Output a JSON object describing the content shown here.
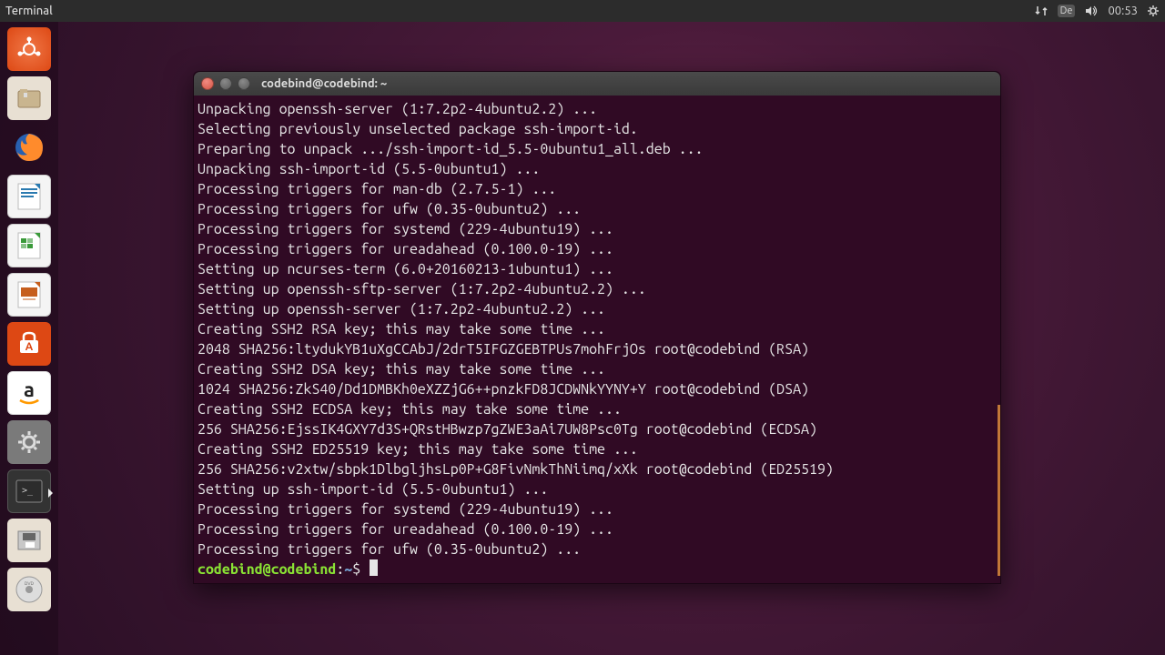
{
  "menubar": {
    "app_name": "Terminal",
    "lang": "De",
    "time": "00:53"
  },
  "terminal": {
    "title": "codebind@codebind: ~",
    "lines": [
      "Unpacking openssh-server (1:7.2p2-4ubuntu2.2) ...",
      "Selecting previously unselected package ssh-import-id.",
      "Preparing to unpack .../ssh-import-id_5.5-0ubuntu1_all.deb ...",
      "Unpacking ssh-import-id (5.5-0ubuntu1) ...",
      "Processing triggers for man-db (2.7.5-1) ...",
      "Processing triggers for ufw (0.35-0ubuntu2) ...",
      "Processing triggers for systemd (229-4ubuntu19) ...",
      "Processing triggers for ureadahead (0.100.0-19) ...",
      "Setting up ncurses-term (6.0+20160213-1ubuntu1) ...",
      "Setting up openssh-sftp-server (1:7.2p2-4ubuntu2.2) ...",
      "Setting up openssh-server (1:7.2p2-4ubuntu2.2) ...",
      "Creating SSH2 RSA key; this may take some time ...",
      "2048 SHA256:ltydukYB1uXgCCAbJ/2drT5IFGZGEBTPUs7mohFrjOs root@codebind (RSA)",
      "Creating SSH2 DSA key; this may take some time ...",
      "1024 SHA256:ZkS40/Dd1DMBKh0eXZZjG6++pnzkFD8JCDWNkYYNY+Y root@codebind (DSA)",
      "Creating SSH2 ECDSA key; this may take some time ...",
      "256 SHA256:EjssIK4GXY7d3S+QRstHBwzp7gZWE3aAi7UW8Psc0Tg root@codebind (ECDSA)",
      "Creating SSH2 ED25519 key; this may take some time ...",
      "256 SHA256:v2xtw/sbpk1DlbgljhsLp0P+G8FivNmkThNiimq/xXk root@codebind (ED25519)",
      "Setting up ssh-import-id (5.5-0ubuntu1) ...",
      "Processing triggers for systemd (229-4ubuntu19) ...",
      "Processing triggers for ureadahead (0.100.0-19) ...",
      "Processing triggers for ufw (0.35-0ubuntu2) ..."
    ],
    "prompt_user": "codebind@codebind",
    "prompt_path": "~",
    "prompt_symbol": "$"
  }
}
